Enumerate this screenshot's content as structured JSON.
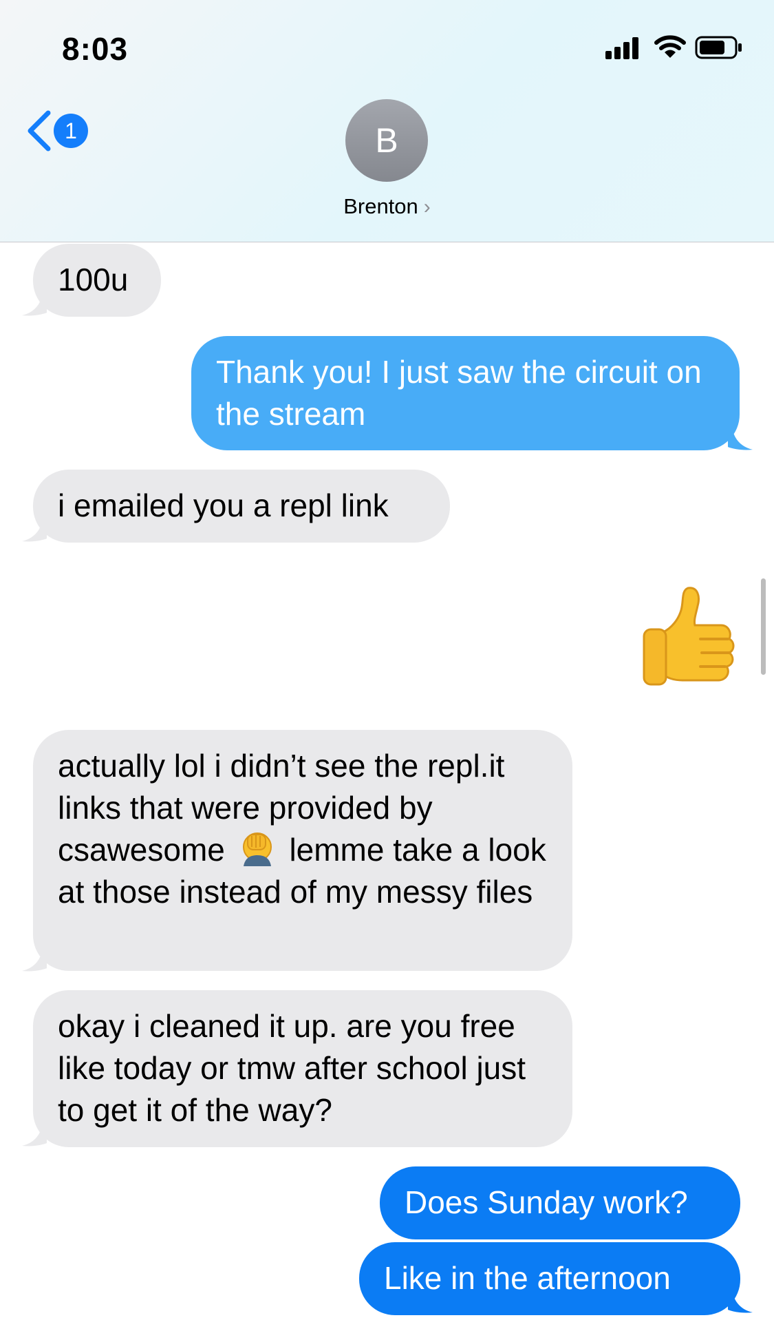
{
  "status_bar": {
    "time": "8:03"
  },
  "nav": {
    "back_badge": "1"
  },
  "contact": {
    "initial": "B",
    "name": "Brenton",
    "chevron": "›"
  },
  "messages": [
    {
      "direction": "received",
      "text": "100u"
    },
    {
      "direction": "sent",
      "text": "Thank you! I just saw the circuit on the stream"
    },
    {
      "direction": "received",
      "text": "i emailed you a repl link"
    },
    {
      "direction": "sent",
      "emoji": "thumbs-up-icon"
    },
    {
      "direction": "received",
      "text_before_emoji": "actually lol i didn’t see the repl.it links that were provided by csawesome",
      "emoji": "face-palm-icon",
      "text_after_emoji": "lemme take a look at those instead of my messy files"
    },
    {
      "direction": "received",
      "text": "okay i cleaned it up. are you free like today or tmw after school just to get it of the way?"
    },
    {
      "direction": "sent",
      "text": "Does Sunday work?"
    },
    {
      "direction": "sent",
      "text": "Like in the afternoon"
    }
  ],
  "colors": {
    "received_bubble": "#e9e9eb",
    "sent_bubble": "#1b8bfa",
    "badge": "#147efb"
  }
}
